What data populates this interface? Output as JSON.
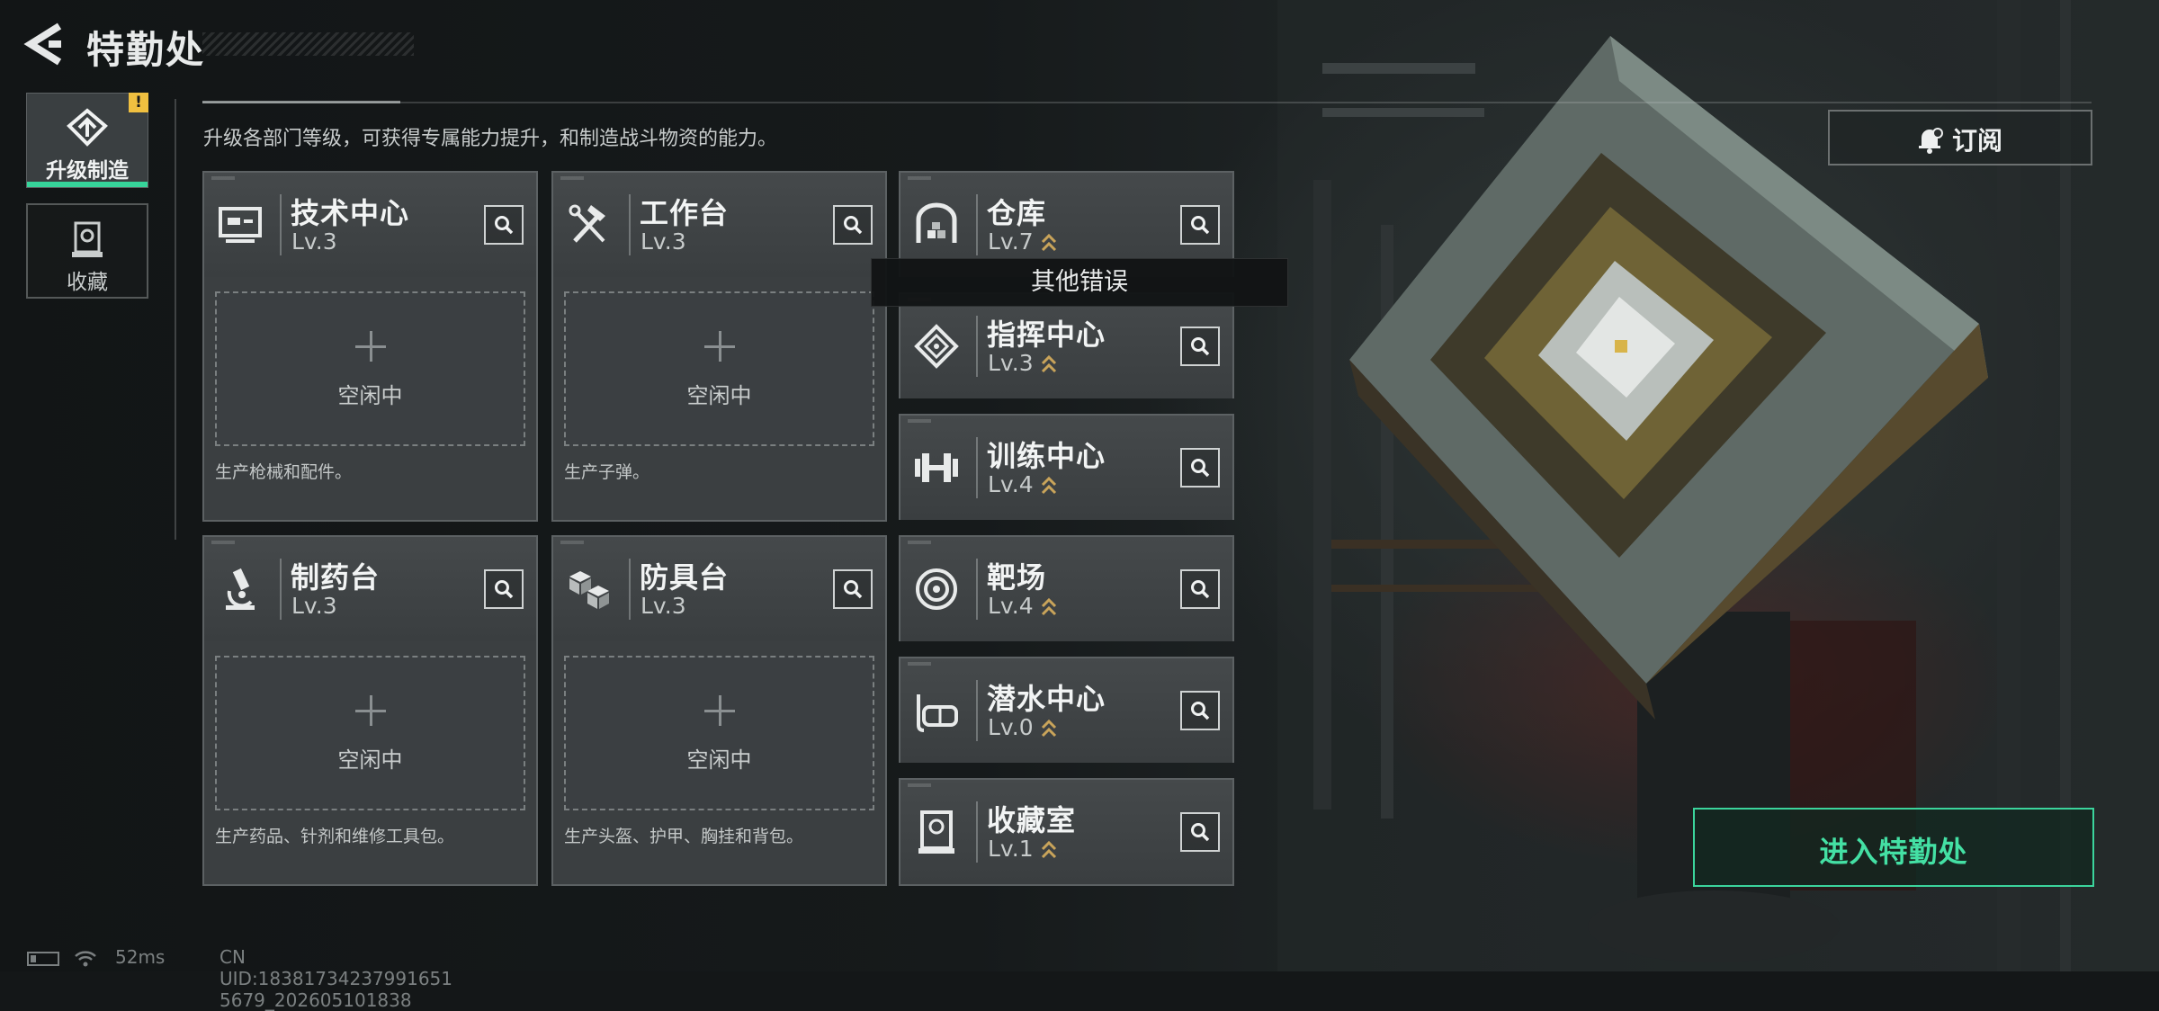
{
  "header": {
    "title": "特勤处",
    "subtitle": "升级各部门等级，可获得专属能力提升，和制造战斗物资的能力。"
  },
  "sidebar": {
    "items": [
      {
        "label": "升级制造",
        "active": true,
        "alert": "!"
      },
      {
        "label": "收藏",
        "active": false
      }
    ]
  },
  "production": [
    {
      "name": "技术中心",
      "level": "Lv.3",
      "slot": "空闲中",
      "desc": "生产枪械和配件。",
      "icon": "monitor-icon"
    },
    {
      "name": "工作台",
      "level": "Lv.3",
      "slot": "空闲中",
      "desc": "生产子弹。",
      "icon": "tools-icon"
    },
    {
      "name": "制药台",
      "level": "Lv.3",
      "slot": "空闲中",
      "desc": "生产药品、针剂和维修工具包。",
      "icon": "microscope-icon"
    },
    {
      "name": "防具台",
      "level": "Lv.3",
      "slot": "空闲中",
      "desc": "生产头盔、护甲、胸挂和背包。",
      "icon": "cubes-icon"
    }
  ],
  "departments": [
    {
      "name": "仓库",
      "level": "Lv.7",
      "upgradable": true,
      "icon": "warehouse-icon"
    },
    {
      "name": "指挥中心",
      "level": "Lv.3",
      "upgradable": true,
      "icon": "command-icon"
    },
    {
      "name": "训练中心",
      "level": "Lv.4",
      "upgradable": true,
      "icon": "dumbbell-icon"
    },
    {
      "name": "靶场",
      "level": "Lv.4",
      "upgradable": true,
      "icon": "target-icon"
    },
    {
      "name": "潜水中心",
      "level": "Lv.0",
      "upgradable": true,
      "icon": "diving-mask-icon"
    },
    {
      "name": "收藏室",
      "level": "Lv.1",
      "upgradable": true,
      "icon": "display-case-icon"
    }
  ],
  "tooltip": "其他错误",
  "actions": {
    "subscribe": "订阅",
    "enter": "进入特勤处"
  },
  "status_bar": {
    "ping": "52ms",
    "uid": "CN UID:18381734237991651 5679_202605101838"
  },
  "colors": {
    "accent_green": "#36d49a",
    "upgrade_gold": "#c9a45a",
    "alert_yellow": "#f0c040"
  }
}
